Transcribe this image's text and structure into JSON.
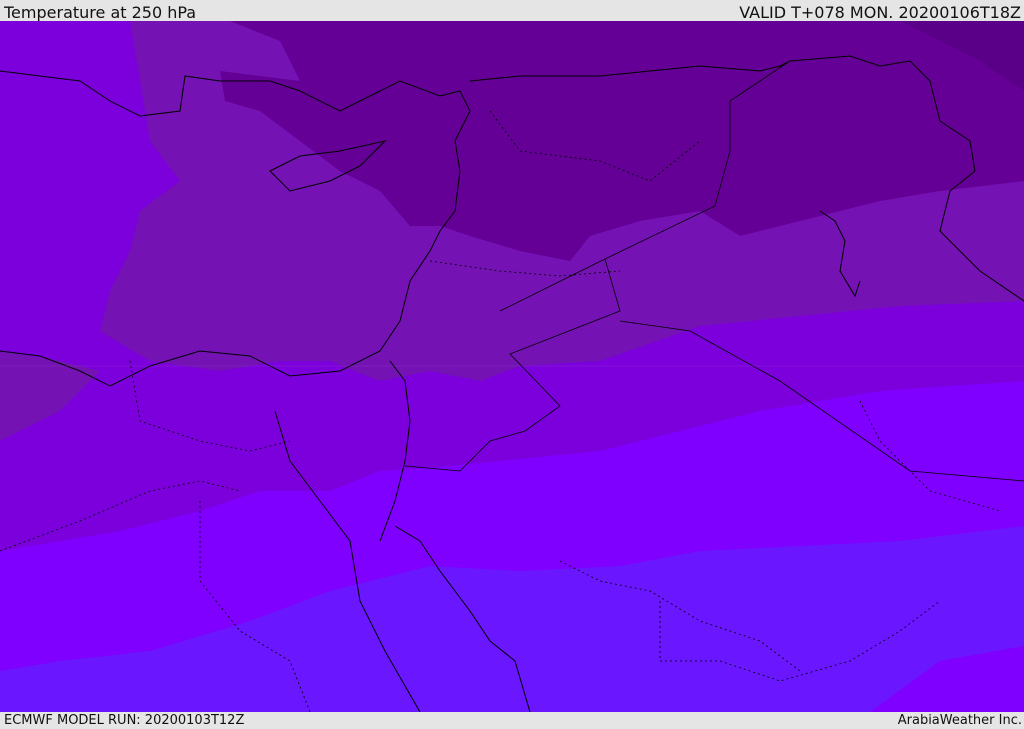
{
  "header": {
    "title": "Temperature at 250 hPa",
    "valid": "VALID T+078 MON. 20200106T18Z"
  },
  "footer": {
    "model_run": "ECMWF MODEL RUN: 20200103T12Z",
    "brand": "ArabiaWeather Inc."
  },
  "colors": {
    "darkest": "#640096",
    "dark": "#7412b4",
    "mid": "#7c00dc",
    "bright": "#8000ff",
    "cold_blue": "#6a16ff"
  }
}
